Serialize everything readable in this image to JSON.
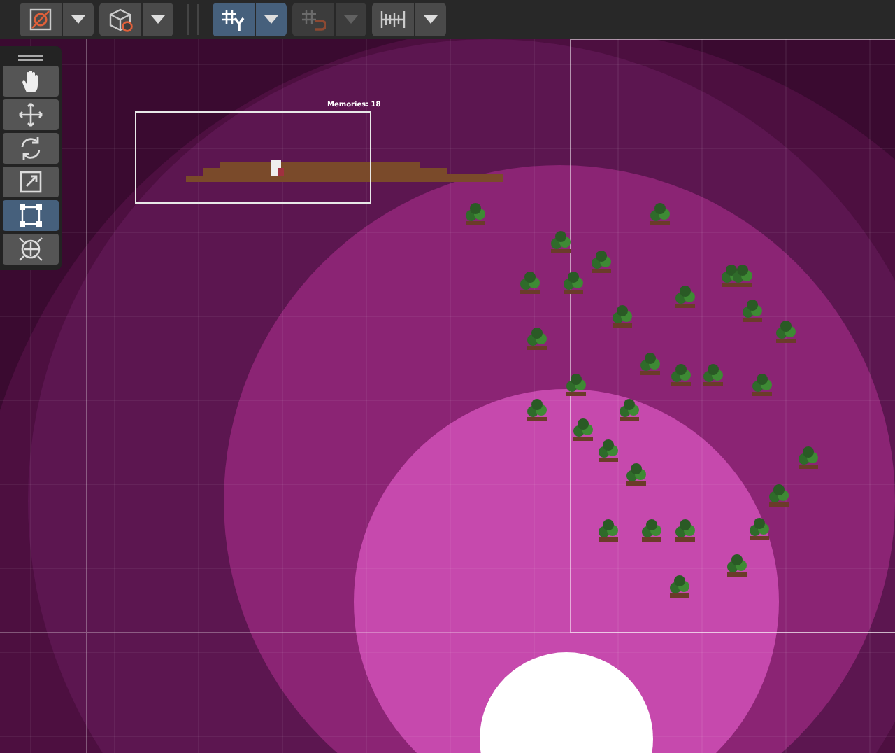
{
  "toolbar": {
    "buttons": [
      {
        "kind": "gizmo",
        "selected": false,
        "disabled": false
      },
      {
        "kind": "cube",
        "selected": false,
        "disabled": false
      },
      {
        "kind": "grid-snap",
        "selected": true,
        "disabled": false
      },
      {
        "kind": "magnet-snap",
        "selected": false,
        "disabled": true
      },
      {
        "kind": "ruler",
        "selected": false,
        "disabled": false
      }
    ]
  },
  "tools": [
    {
      "kind": "hand",
      "selected": false
    },
    {
      "kind": "move",
      "selected": false
    },
    {
      "kind": "rotate",
      "selected": false
    },
    {
      "kind": "scale",
      "selected": false
    },
    {
      "kind": "rect",
      "selected": true
    },
    {
      "kind": "transform",
      "selected": false
    }
  ],
  "scene": {
    "label": "Memories: 18"
  }
}
